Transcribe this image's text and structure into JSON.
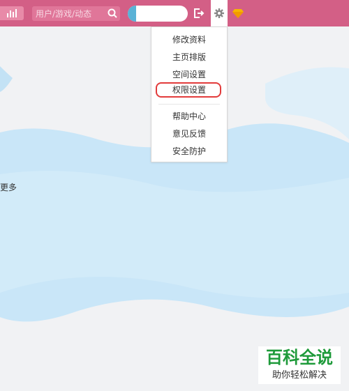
{
  "topbar": {
    "search": {
      "placeholder": "用户/游戏/动态"
    },
    "icons": {
      "chart": "bar-chart-icon",
      "search": "search-icon",
      "logout": "logout-icon",
      "settings": "gear-icon",
      "vip": "diamond-icon"
    }
  },
  "menu": {
    "items": [
      {
        "label": "修改资料"
      },
      {
        "label": "主页排版"
      },
      {
        "label": "空间设置"
      },
      {
        "label": "权限设置"
      },
      {
        "label": "帮助中心"
      },
      {
        "label": "意见反馈"
      },
      {
        "label": "安全防护"
      }
    ],
    "highlighted_item": "权限设置"
  },
  "main": {
    "more_text": "更多"
  },
  "watermark": {
    "title": "百科全说",
    "subtitle": "助你轻松解决"
  },
  "colors": {
    "topbar": "#d35f86",
    "wave": "#c9e6f8",
    "highlight": "#e23b3b",
    "watermark_green": "#1e9a3a"
  }
}
